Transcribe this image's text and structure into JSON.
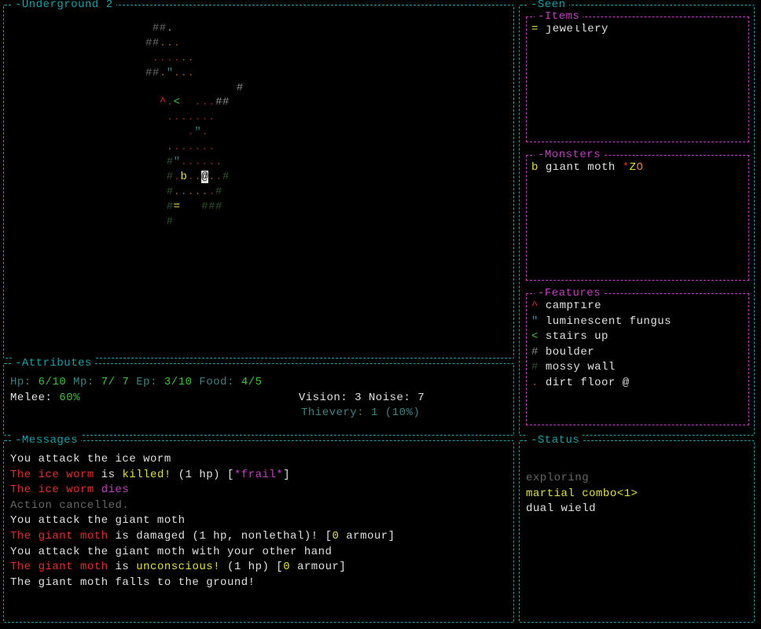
{
  "map_panel": {
    "title": "-Underground 2"
  },
  "seen_panel": {
    "title": "-Seen",
    "items_title": "-Items",
    "items": [
      {
        "sym": "=",
        "symcolor": "yellow",
        "name": "jewellery"
      }
    ],
    "monsters_title": "-Monsters",
    "monsters": [
      {
        "sym": "b",
        "symcolor": "yellow",
        "name": "giant moth",
        "suffix_star": "*",
        "suffix_z": "Z",
        "suffix_o": "O"
      }
    ],
    "features_title": "-Features",
    "features": [
      {
        "sym": "^",
        "symcolor": "red",
        "name": "campfire"
      },
      {
        "sym": "\"",
        "symcolor": "cyan",
        "name": "luminescent fungus"
      },
      {
        "sym": "<",
        "symcolor": "green",
        "name": "stairs up"
      },
      {
        "sym": "#",
        "symcolor": "gray",
        "name": "boulder"
      },
      {
        "sym": "#",
        "symcolor": "dimgreen",
        "name": "mossy wall"
      },
      {
        "sym": ".",
        "symcolor": "brown",
        "name": "dirt floor",
        "suffix": "@"
      }
    ]
  },
  "attributes": {
    "title": "-Attributes",
    "hp": "6/10",
    "mp": "7/ 7",
    "ep": "3/10",
    "food": "4/5",
    "melee": "60%",
    "vision": "3",
    "noise": "7",
    "thievery": "1 (10%)"
  },
  "messages": {
    "title": "-Messages",
    "lines": [
      [
        {
          "t": "You attack the ice worm",
          "c": "white"
        }
      ],
      [
        {
          "t": "The ice worm",
          "c": "red"
        },
        {
          "t": " is ",
          "c": "white"
        },
        {
          "t": "killed!",
          "c": "yellow"
        },
        {
          "t": " (1 hp) [",
          "c": "white"
        },
        {
          "t": "*frail*",
          "c": "magenta"
        },
        {
          "t": "]",
          "c": "white"
        }
      ],
      [
        {
          "t": "The ice worm",
          "c": "red"
        },
        {
          "t": " ",
          "c": "white"
        },
        {
          "t": "dies",
          "c": "magenta"
        }
      ],
      [
        {
          "t": "Action cancelled.",
          "c": "darkgray"
        }
      ],
      [
        {
          "t": "You attack the giant moth",
          "c": "white"
        }
      ],
      [
        {
          "t": "The giant moth",
          "c": "red"
        },
        {
          "t": " is damaged (1 hp, nonlethal)! [",
          "c": "white"
        },
        {
          "t": "0",
          "c": "yellow"
        },
        {
          "t": " armour]",
          "c": "white"
        }
      ],
      [
        {
          "t": "You attack the giant moth with your other hand",
          "c": "white"
        }
      ],
      [
        {
          "t": "The giant moth",
          "c": "red"
        },
        {
          "t": " is ",
          "c": "white"
        },
        {
          "t": "unconscious!",
          "c": "yellow"
        },
        {
          "t": " (1 hp) [",
          "c": "white"
        },
        {
          "t": "0",
          "c": "yellow"
        },
        {
          "t": " armour]",
          "c": "white"
        }
      ],
      [
        {
          "t": "The giant moth falls to the ground!",
          "c": "white"
        }
      ]
    ]
  },
  "status": {
    "title": "-Status",
    "lines": [
      {
        "t": "exploring",
        "c": "darkgray"
      },
      {
        "t": "martial combo<1>",
        "c": "yellow"
      },
      {
        "t": "dual wield",
        "c": "white"
      }
    ]
  },
  "labels": {
    "hp": "Hp:",
    "mp": "Mp:",
    "ep": "Ep:",
    "food": "Food:",
    "melee": "Melee:",
    "vision": "Vision:",
    "noise": "Noise:",
    "thievery": "Thievery:"
  }
}
